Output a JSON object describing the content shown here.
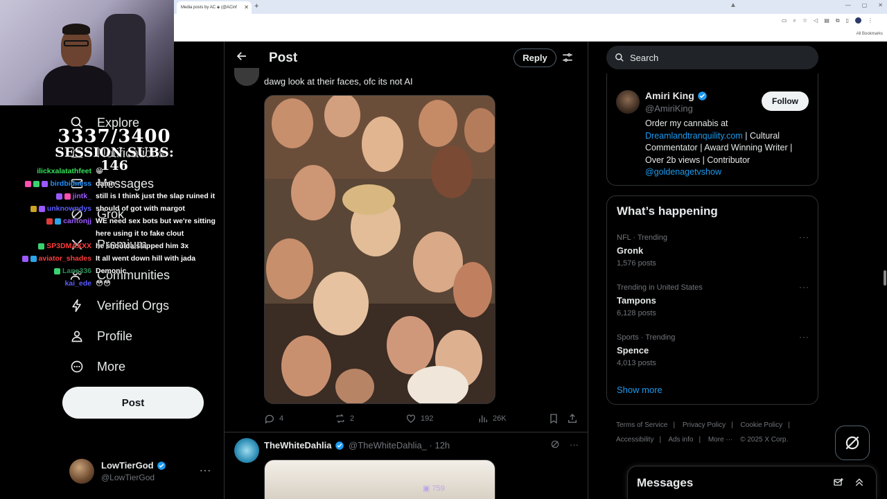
{
  "browser": {
    "tab_title": "Media posts by AC ◈ (@ACinf",
    "tab_close": "✕",
    "new_tab": "+",
    "bookmarks_label": "All Bookmarks",
    "window_controls": [
      "—",
      "▢",
      "✕"
    ]
  },
  "stream": {
    "goal_count": "3337/3400",
    "goal_label": "SESSION SUBS: 146",
    "chat": [
      {
        "user": "ilickxalatathfeet",
        "user_color": "#35e05b",
        "msg": "😁",
        "badges": []
      },
      {
        "user": "birdbidness",
        "user_color": "#1e90ff",
        "msg": "damn",
        "badges": [
          "#ff4fb0",
          "#3bd16f",
          "#9b59ff"
        ]
      },
      {
        "user": "jintk_",
        "user_color": "#9b59ff",
        "msg": "still is I think just the slap ruined it",
        "badges": [
          "#9b59ff",
          "#ff4fb0"
        ]
      },
      {
        "user": "unknowndys",
        "user_color": "#5a5aff",
        "msg": "should of got with margot",
        "badges": [
          "#c9a227",
          "#9b59ff"
        ]
      },
      {
        "user": "carltonjj",
        "user_color": "#9b59ff",
        "msg": "WE need sex bots but we're sitting",
        "badges": [
          "#e03b3b",
          "#2fa4e7"
        ]
      },
      {
        "user": "",
        "user_color": "#ffffff",
        "msg": "here using it to fake clout",
        "badges": []
      },
      {
        "user": "SP3DMAXXX",
        "user_color": "#ff3b3b",
        "msg": "he shoulda slapped him 3x",
        "badges": [
          "#3bd16f"
        ]
      },
      {
        "user": "aviator_shades",
        "user_color": "#ff3b3b",
        "msg": "It all went down hill with jada",
        "badges": [
          "#9b59ff",
          "#2fa4e7"
        ]
      },
      {
        "user": "Lane336",
        "user_color": "#2e8b57",
        "msg": "Demonic",
        "badges": [
          "#3bd16f"
        ]
      },
      {
        "user": "kai_ede",
        "user_color": "#5a5aff",
        "msg": "😳😳",
        "badges": []
      }
    ]
  },
  "nav": {
    "items": [
      {
        "label": "Explore",
        "icon": "search-icon"
      },
      {
        "label": "Notifications",
        "icon": "bell-icon"
      },
      {
        "label": "Messages",
        "icon": "envelope-icon"
      },
      {
        "label": "Grok",
        "icon": "grok-icon"
      },
      {
        "label": "Premium",
        "icon": "x-logo-icon"
      },
      {
        "label": "Communities",
        "icon": "people-icon"
      },
      {
        "label": "Verified Orgs",
        "icon": "lightning-icon"
      },
      {
        "label": "Profile",
        "icon": "person-icon"
      },
      {
        "label": "More",
        "icon": "more-circle-icon"
      }
    ],
    "post_button": "Post",
    "account": {
      "name": "LowTierGod",
      "handle": "@LowTierGod",
      "more": "···"
    }
  },
  "center": {
    "title": "Post",
    "reply_button": "Reply",
    "reply": {
      "text": "dawg look at their faces, ofc its not AI"
    },
    "stats": {
      "replies": "4",
      "reposts": "2",
      "likes": "192",
      "views": "26K"
    },
    "next_post": {
      "name": "TheWhiteDahlia",
      "handle": "@TheWhiteDahlia_ · 12h"
    },
    "overlay_watermark": "759"
  },
  "right": {
    "search_placeholder": "Search",
    "profile": {
      "name": "Amiri King",
      "handle": "@AmiriKing",
      "follow": "Follow",
      "bio_1": "Order my cannabis at",
      "bio_link": "Dreamlandtranquility.com",
      "bio_2": " | Cultural Commentator | Award Winning Writer | Over 2b views | Contributor",
      "bio_mention": "@goldenagetvshow"
    },
    "happening": {
      "title": "What’s happening",
      "trends": [
        {
          "meta": "NFL · Trending",
          "name": "Gronk",
          "count": "1,576 posts"
        },
        {
          "meta": "Trending in United States",
          "name": "Tampons",
          "count": "6,128 posts"
        },
        {
          "meta": "Sports · Trending",
          "name": "Spence",
          "count": "4,013 posts"
        }
      ],
      "show_more": "Show more"
    },
    "footer": {
      "links": [
        "Terms of Service",
        "|",
        "Privacy Policy",
        "|",
        "Cookie Policy",
        "|",
        "Accessibility",
        "|",
        "Ads info",
        "|",
        "More ···",
        "© 2025 X Corp."
      ]
    },
    "messages": {
      "title": "Messages"
    }
  },
  "colors": {
    "accent": "#1d9bf0",
    "bg": "#000000",
    "border": "#2f3336",
    "muted": "#71767b"
  }
}
